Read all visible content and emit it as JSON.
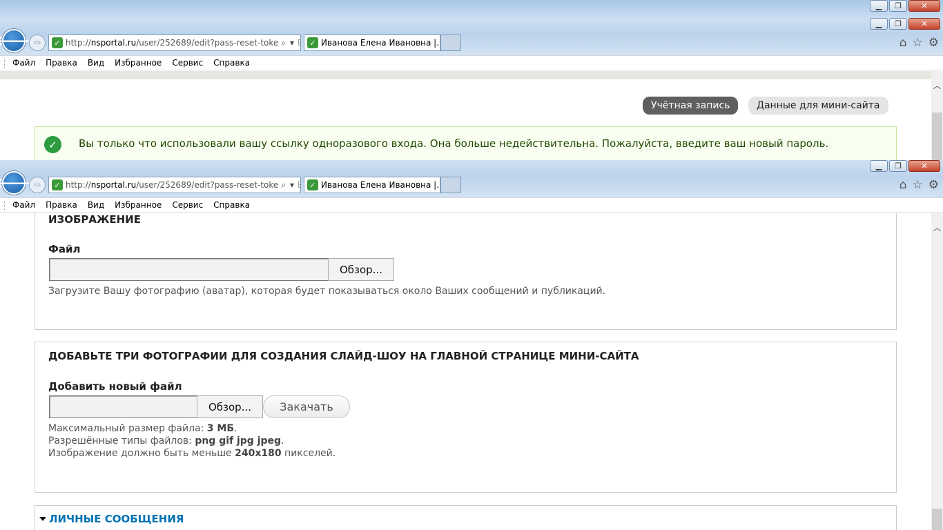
{
  "browser": {
    "url_prefix": "http://",
    "url_domain": "nsportal.ru",
    "url_path": "/user/252689/edit?pass-reset-toke",
    "tab_title": "Иванова Елена Ивановна |...",
    "menu": [
      "Файл",
      "Правка",
      "Вид",
      "Избранное",
      "Сервис",
      "Справка"
    ],
    "win_min": "▁",
    "win_max": "❐",
    "win_close": "✕"
  },
  "account_tabs": {
    "account": "Учётная запись",
    "minisite": "Данные для мини-сайта"
  },
  "status_message": "Вы только что использовали вашу ссылку одноразового входа. Она больше недействительна. Пожалуйста, введите ваш новый пароль.",
  "image_section": {
    "legend": "ИЗОБРАЖЕНИЕ",
    "file_label": "Файл",
    "browse": "Обзор...",
    "description": "Загрузите Вашу фотографию (аватар), которая будет показываться около Ваших сообщений и публикаций."
  },
  "slideshow_section": {
    "legend": "ДОБАВЬТЕ ТРИ ФОТОГРАФИИ ДЛЯ СОЗДАНИЯ СЛАЙД-ШОУ НА ГЛАВНОЙ СТРАНИЦЕ МИНИ-САЙТА",
    "file_label": "Добавить новый файл",
    "browse": "Обзор...",
    "upload": "Закачать",
    "max_size_label": "Максимальный размер файла:",
    "max_size_value": "3 МБ",
    "types_label": "Разрешённые типы файлов:",
    "types_value": "png gif jpg jpeg",
    "dims_label": "Изображение должно быть меньше",
    "dims_value": "240x180",
    "dims_suffix": "пикселей."
  },
  "private_messages": {
    "title": "ЛИЧНЫЕ СООБЩЕНИЯ"
  }
}
